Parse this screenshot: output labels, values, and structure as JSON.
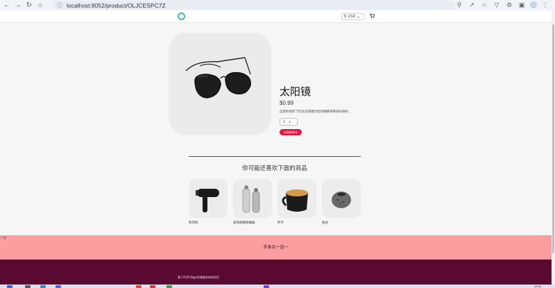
{
  "browser": {
    "url": "localhost:8052/product/OLJCESPC7Z",
    "icons": [
      "back-icon",
      "forward-icon",
      "reload-icon",
      "home-icon",
      "info-icon",
      "zoom-icon",
      "share-icon",
      "star-icon",
      "vpn-icon",
      "extensions-icon",
      "sidepanel-icon",
      "profile-icon"
    ]
  },
  "header": {
    "currency_symbol": "$",
    "currency": "USD",
    "logo_color": "#40b7b0"
  },
  "product": {
    "title": "太阳镜",
    "price": "$0.99",
    "description": "这款时尚的飞行员太阳镜为您的眼睛带来阳光保护。",
    "quantity": "1",
    "add_to_cart": "加到购物车",
    "button_color": "#e4143d"
  },
  "recommendations": {
    "title": "你可能还喜欢下面的商品",
    "items": [
      {
        "name": "吹风机",
        "icon": "hair-dryer-icon"
      },
      {
        "name": "盐和胡椒研磨器",
        "icon": "salt-pepper-icon"
      },
      {
        "name": "杯子",
        "icon": "mug-icon"
      },
      {
        "name": "烛台",
        "icon": "candle-holder-icon"
      }
    ]
  },
  "ad": {
    "tag": "广告",
    "text": "手表买一送一",
    "color": "#fd9d9f"
  },
  "footer": {
    "text": "基于OSPC和go的微服务电商项目",
    "color": "#5a0931"
  },
  "taskbar": {
    "time": "12:00"
  }
}
